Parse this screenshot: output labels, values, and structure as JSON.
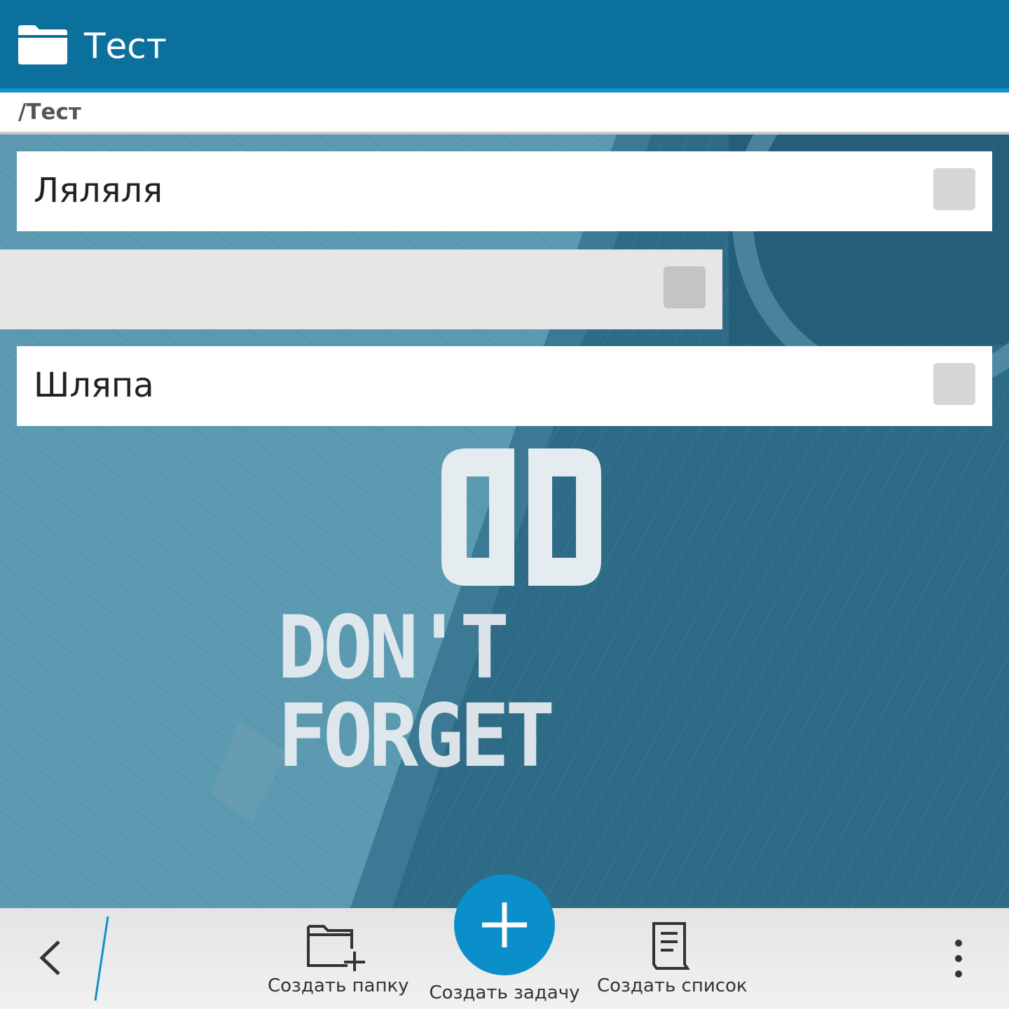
{
  "header": {
    "title": "Тест",
    "icon": "folder-icon"
  },
  "breadcrumb": {
    "path": "/Тест"
  },
  "tasks": [
    {
      "label": "Ляляля",
      "checked": false
    },
    {
      "label": "",
      "checked": false
    },
    {
      "label": "Шляпа",
      "checked": false
    }
  ],
  "logo": {
    "text": "DON'T FORGET"
  },
  "bottombar": {
    "actions": [
      {
        "label": "Создать папку",
        "icon": "folder-add-icon"
      },
      {
        "label": "Создать задачу",
        "icon": "plus-icon"
      },
      {
        "label": "Создать список",
        "icon": "list-icon"
      }
    ]
  },
  "colors": {
    "header": "#0b719c",
    "accent": "#1190c9",
    "fab": "#0a8fcb"
  }
}
